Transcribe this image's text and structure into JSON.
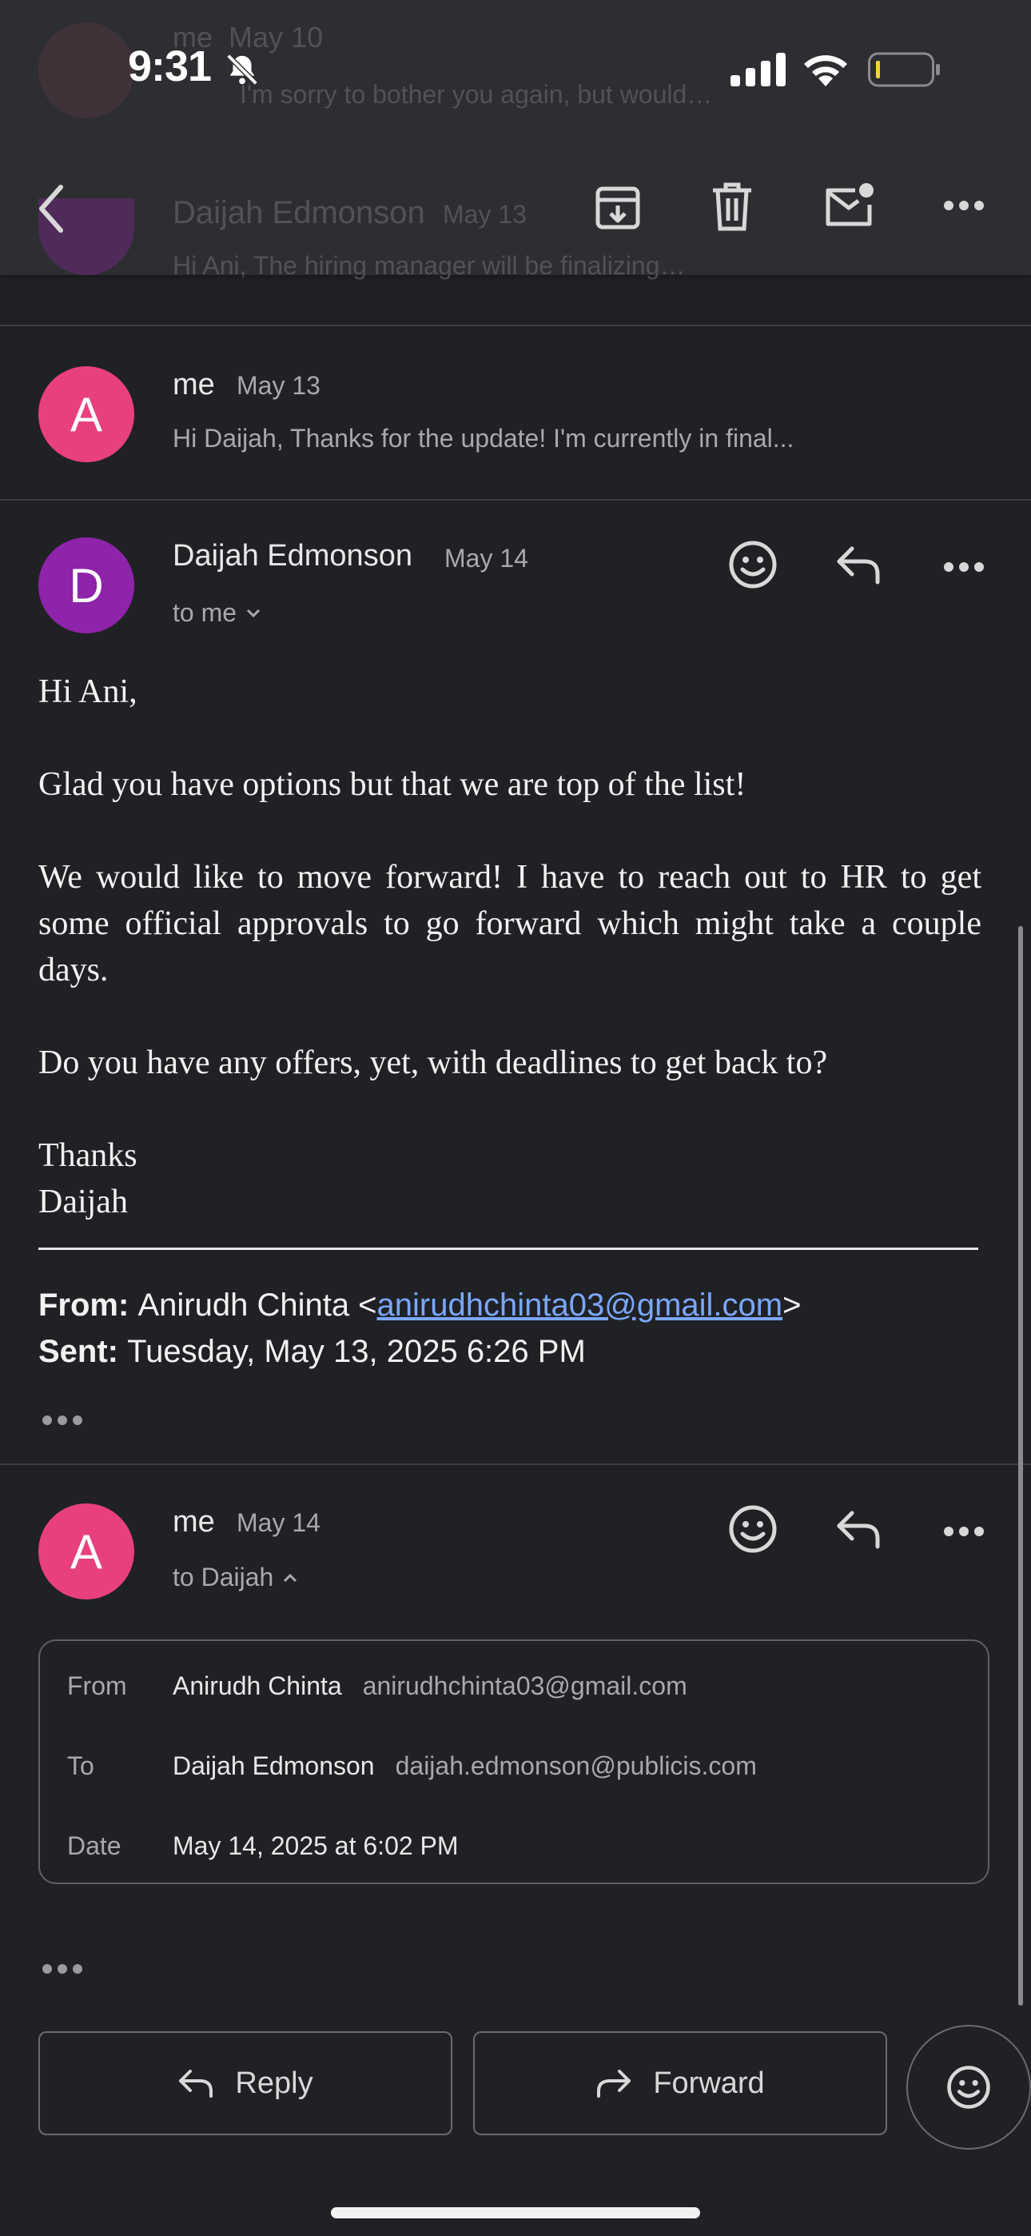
{
  "status_bar": {
    "time": "9:31"
  },
  "toolbar": {
    "behind": {
      "msg1_sender": "me",
      "msg1_date": "May 10",
      "msg1_snippet": "I'm sorry to bother you again, but would…",
      "msg2_sender": "Daijah Edmonson",
      "msg2_date": "May 13",
      "msg2_snippet": "Hi Ani, The hiring manager will be finalizing…"
    }
  },
  "thread": [
    {
      "avatar_letter": "A",
      "sender": "me",
      "date": "May 13",
      "snippet": "Hi Daijah, Thanks for the update! I'm currently in final..."
    },
    {
      "avatar_letter": "D",
      "sender": "Daijah Edmonson",
      "date": "May 14",
      "recipient": "to me",
      "body": [
        "Hi Ani,",
        "Glad you have options but that we are top of the list!",
        "We would like to move forward! I have to reach out to HR to get some official approvals to go forward which might take a couple days.",
        "Do you have any offers, yet, with deadlines to get back to?",
        "Thanks",
        "Daijah"
      ],
      "quoted": {
        "from_label": "From:",
        "from_name": "Anirudh Chinta <",
        "from_email": "anirudhchinta03@gmail.com",
        "from_close": ">",
        "sent_label": "Sent:",
        "sent_value": "Tuesday, May 13, 2025 6:26 PM"
      }
    },
    {
      "avatar_letter": "A",
      "sender": "me",
      "date": "May 14",
      "recipient": "to Daijah",
      "details": {
        "from_label": "From",
        "from_name": "Anirudh Chinta",
        "from_email": "anirudhchinta03@gmail.com",
        "to_label": "To",
        "to_name": "Daijah Edmonson",
        "to_email": "daijah.edmonson@publicis.com",
        "date_label": "Date",
        "date_value": "May 14, 2025 at 6:02 PM"
      }
    }
  ],
  "actions": {
    "reply_label": "Reply",
    "forward_label": "Forward"
  },
  "colors": {
    "background": "#202124",
    "toolbar": "#2d2e31",
    "avatar_me": "#e8407e",
    "avatar_daijah": "#8e24aa",
    "link": "#7aa7ff"
  }
}
